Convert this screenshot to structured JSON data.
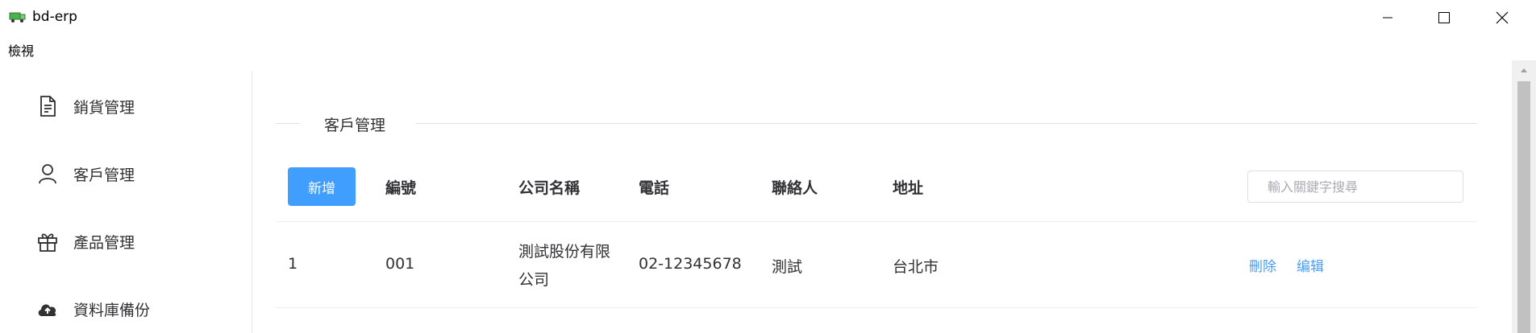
{
  "window": {
    "title": "bd-erp",
    "menu": [
      "檢視"
    ]
  },
  "sidebar": {
    "items": [
      {
        "label": "銷貨管理",
        "icon": "document-icon"
      },
      {
        "label": "客戶管理",
        "icon": "user-icon"
      },
      {
        "label": "產品管理",
        "icon": "gift-icon"
      },
      {
        "label": "資料庫備份",
        "icon": "upload-cloud-icon"
      }
    ]
  },
  "main": {
    "section_title": "客戶管理",
    "add_button": "新增",
    "search_placeholder": "輸入關鍵字搜尋",
    "columns": [
      "編號",
      "公司名稱",
      "電話",
      "聯絡人",
      "地址"
    ],
    "rows": [
      {
        "index": "1",
        "code": "001",
        "company": "測試股份有限公司",
        "phone": "02-12345678",
        "contact": "測試",
        "address": "台北市",
        "actions": [
          "刪除",
          "编辑"
        ]
      }
    ]
  },
  "colors": {
    "primary": "#409eff",
    "text": "#303133",
    "border": "#dcdfe6"
  }
}
